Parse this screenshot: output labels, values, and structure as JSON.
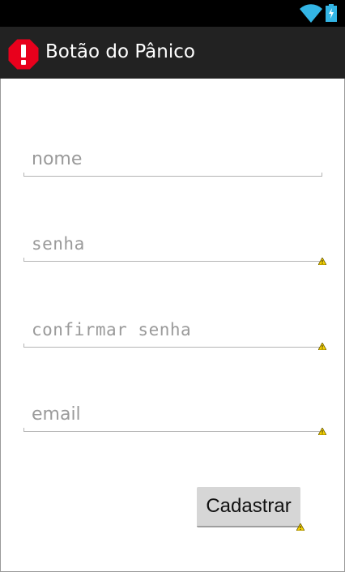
{
  "app": {
    "title": "Botão do Pânico"
  },
  "icons": {
    "app": "panic-alert-icon",
    "wifi": "wifi-icon",
    "battery": "battery-charging-icon",
    "warning": "warning-icon"
  },
  "form": {
    "nome": {
      "placeholder": "nome",
      "value": ""
    },
    "senha": {
      "placeholder": "senha",
      "value": ""
    },
    "confirmar": {
      "placeholder": "confirmar senha",
      "value": ""
    },
    "email": {
      "placeholder": "email",
      "value": ""
    },
    "submit_label": "Cadastrar"
  },
  "colors": {
    "status_bar": "#000000",
    "action_bar": "#222222",
    "wifi": "#33b5e5",
    "alert_red": "#e8001c",
    "warning_yellow": "#f5d100"
  }
}
